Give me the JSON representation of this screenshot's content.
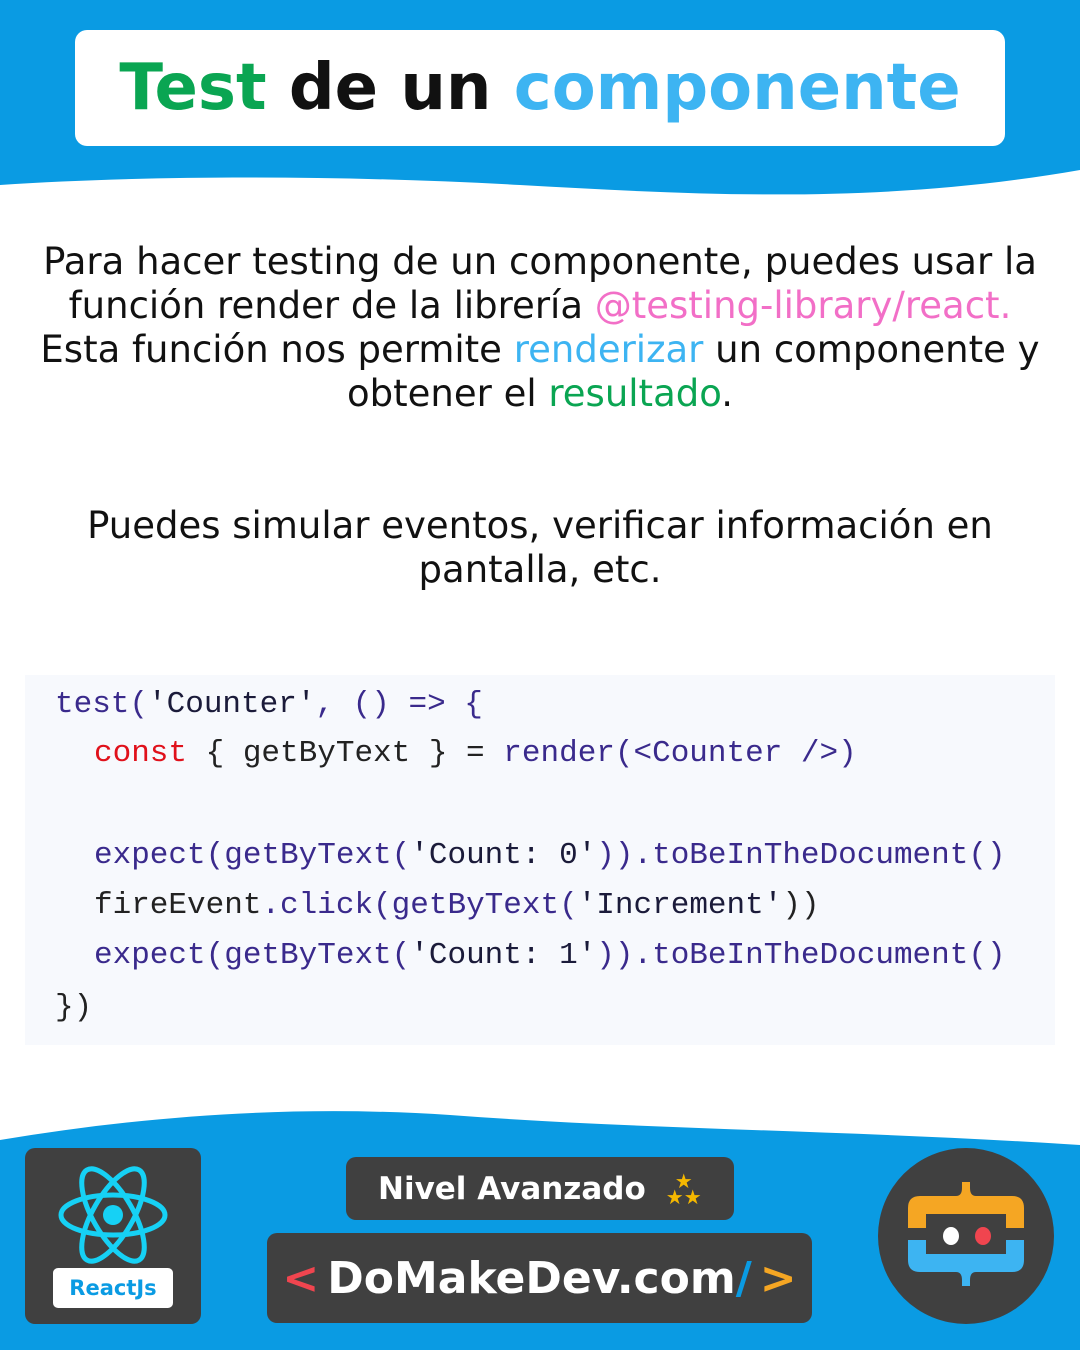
{
  "title": {
    "word1": "Test",
    "word2": " de un ",
    "word3": "componente"
  },
  "paragraph1": {
    "t1": "Para hacer testing de un componente, puedes usar la función render de la librería ",
    "link": "@testing-library/react.",
    "t2": " Esta función nos permite ",
    "hl1": "renderizar",
    "t3": " un componente y obtener el ",
    "hl2": "resultado",
    "t4": "."
  },
  "paragraph2": "Puedes simular eventos, verificar información en pantalla, etc.",
  "code": {
    "l1": {
      "a": "test(",
      "b": "'Counter'",
      "c": ", () => {"
    },
    "l2": {
      "a": "const",
      "b": " { getByText } = ",
      "c": "render(<Counter />)"
    },
    "l3": {
      "a": "expect(getByText(",
      "b": "'Count: 0'",
      "c": ")).toBeInTheDocument()"
    },
    "l4": {
      "a": "fireEvent",
      "b": ".click(getByText(",
      "c": "'Increment'",
      "d": "))"
    },
    "l5": {
      "a": "expect(getByText(",
      "b": "'Count: 1'",
      "c": ")).toBeInTheDocument()"
    },
    "l6": "})"
  },
  "footer": {
    "badge": "ReactJs",
    "level": "Nivel Avanzado",
    "site_open": "<",
    "site": "DoMakeDev.com",
    "site_slash": "/",
    "site_close": ">"
  },
  "colors": {
    "blue": "#0a9be3",
    "dark": "#404040",
    "green": "#0aa552",
    "pink": "#f26fc7",
    "accent": "#3db4f2"
  }
}
